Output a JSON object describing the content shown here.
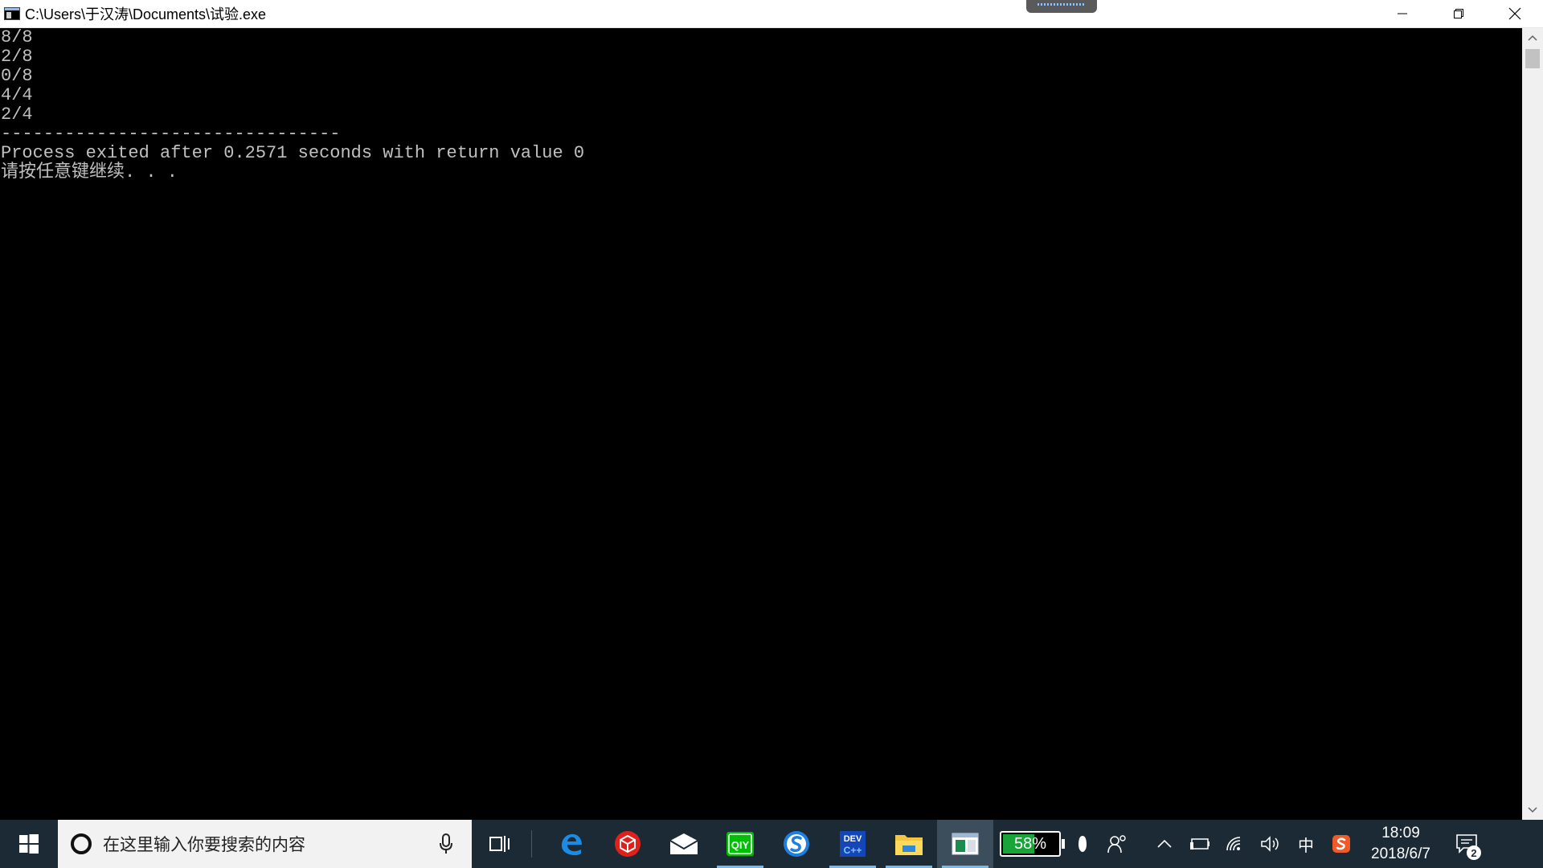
{
  "window": {
    "title": "C:\\Users\\于汉涛\\Documents\\试验.exe"
  },
  "console": {
    "lines": [
      "8/8",
      "2/8",
      "0/8",
      "4/4",
      "2/4",
      "--------------------------------",
      "Process exited after 0.2571 seconds with return value 0",
      "请按任意键继续. . ."
    ]
  },
  "taskbar": {
    "search_placeholder": "在这里输入你要搜索的内容",
    "apps": [
      {
        "icon": "edge-icon"
      },
      {
        "icon": "red-box-app-icon"
      },
      {
        "icon": "mail-icon"
      },
      {
        "icon": "iqiyi-icon"
      },
      {
        "icon": "sogou-browser-icon"
      },
      {
        "icon": "dev-cpp-icon"
      },
      {
        "icon": "file-explorer-icon"
      },
      {
        "icon": "console-window-icon"
      }
    ],
    "battery": {
      "percent_text": "58%",
      "level": 0.58
    },
    "ime_label": "中",
    "clock": {
      "time": "18:09",
      "date": "2018/6/7"
    },
    "notification_count": "2"
  }
}
